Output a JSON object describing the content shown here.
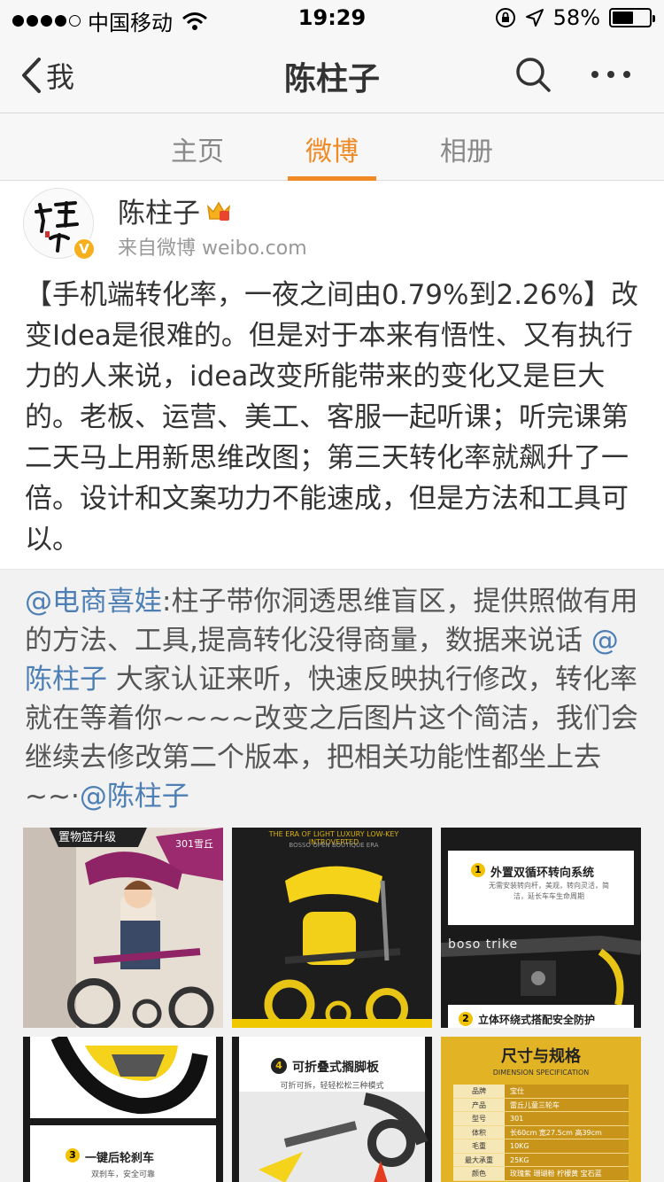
{
  "status_bar": {
    "carrier": "中国移动",
    "time": "19:29",
    "battery_percent": "58%",
    "battery_level": 0.58
  },
  "nav": {
    "back_label": "我",
    "title": "陈柱子"
  },
  "tabs": [
    {
      "label": "主页",
      "active": false
    },
    {
      "label": "微博",
      "active": true
    },
    {
      "label": "相册",
      "active": false
    }
  ],
  "colors": {
    "accent": "#f08a24",
    "mention": "#4d7fb4",
    "verified_badge": "#f6b01e"
  },
  "post": {
    "author": "陈柱子",
    "source": "来自微博 weibo.com",
    "avatar_text": "柱子",
    "text": "【手机端转化率，一夜之间由0.79%到2.26%】改变Idea是很难的。但是对于本来有悟性、又有执行力的人来说，idea改变所能带来的变化又是巨大的。老板、运营、美工、客服一起听课；听完课第二天马上用新思维改图；第三天转化率就飙升了一倍。设计和文案功力不能速成，但是方法和工具可以。"
  },
  "retweet": {
    "mention1": "@电商喜娃",
    "text1": ":柱子带你洞透思维盲区，提供照做有用的方法、工具,提高转化没得商量，数据来说话 ",
    "mention2": "@陈柱子",
    "text2": " 大家认证来听，快速反映执行修改，转化率就在等着你~~~~改变之后图片这个简洁，我们会继续去修改第二个版本，把相关功能性都坐上去~~·",
    "mention3": "@陈柱子"
  },
  "images": [
    {
      "caption_top": "置物篮升级",
      "caption_sub": "301雪丘"
    },
    {
      "caption_top": "THE ERA OF LIGHT LUXURY LOW-KEY INTROVERTED",
      "caption_sub": "BOSSO OPEN BOUTIQUE ERA"
    },
    {
      "feature1_num": "1",
      "feature1": "外置双循环转向系统",
      "feature1_desc": "无需安装转向杆，美观，转向灵活，简洁，延长车车生命周期",
      "brand": "boso trike",
      "feature2_num": "2",
      "feature2": "立体环绕式搭配安全防护"
    },
    {
      "feature_num": "3",
      "feature": "一键后轮刹车",
      "feature_desc": "双刹车，安全可靠"
    },
    {
      "feature_num": "4",
      "feature": "可折叠式搁脚板",
      "feature_desc": "可折可拆，轻轻松松三种模式"
    },
    {
      "title": "尺寸与规格",
      "subtitle": "DIMENSION SPECIFICATION",
      "rows": [
        [
          "品牌",
          "宝仕"
        ],
        [
          "产品",
          "雷丘儿童三轮车"
        ],
        [
          "型号",
          "301"
        ],
        [
          "体积",
          "长60cm 宽27.5cm 高39cm"
        ],
        [
          "毛重",
          "10KG"
        ],
        [
          "最大承重",
          "25KG"
        ],
        [
          "颜色",
          "玫瑰紫 珊瑚粉 柠檬黄 宝石蓝"
        ]
      ]
    }
  ]
}
